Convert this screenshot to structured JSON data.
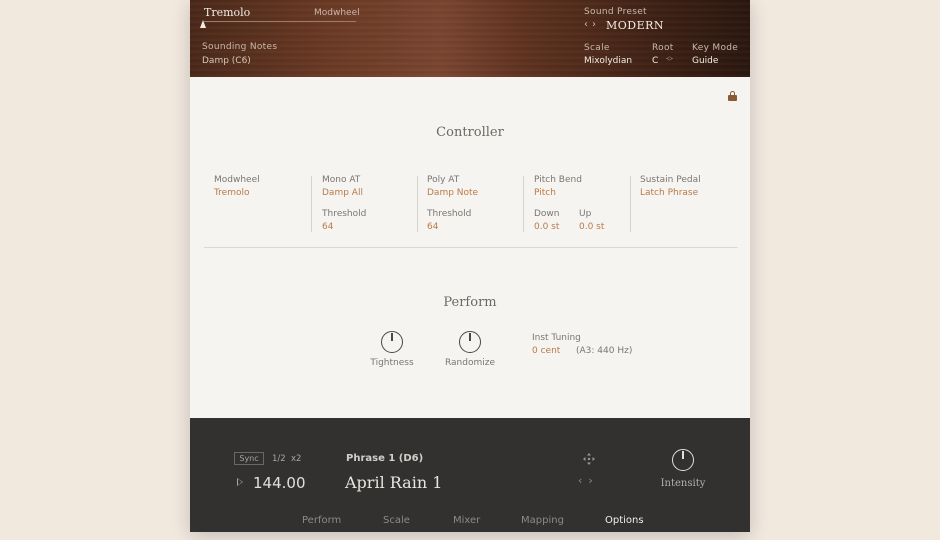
{
  "header": {
    "modwheel_target": "Tremolo",
    "modwheel_label": "Modwheel",
    "sounding_notes_label": "Sounding Notes",
    "sounding_notes_value": "Damp (C6)",
    "sound_preset_label": "Sound Preset",
    "preset_prev": "‹",
    "preset_next": "›",
    "sound_preset_value": "MODERN",
    "scale_label": "Scale",
    "scale_value": "Mixolydian",
    "root_label": "Root",
    "root_value": "C",
    "key_mode_label": "Key Mode",
    "key_mode_value": "Guide",
    "lock_icon": "lock-icon"
  },
  "controller": {
    "title": "Controller",
    "columns": [
      {
        "label": "Modwheel",
        "value": "Tremolo"
      },
      {
        "label": "Mono AT",
        "value": "Damp All",
        "sub_label": "Threshold",
        "sub_value": "64"
      },
      {
        "label": "Poly AT",
        "value": "Damp Note",
        "sub_label": "Threshold",
        "sub_value": "64"
      },
      {
        "label": "Pitch Bend",
        "value": "Pitch",
        "down_label": "Down",
        "down_value": "0.0 st",
        "up_label": "Up",
        "up_value": "0.0 st"
      },
      {
        "label": "Sustain Pedal",
        "value": "Latch Phrase"
      }
    ]
  },
  "perform": {
    "title": "Perform",
    "tightness_label": "Tightness",
    "randomize_label": "Randomize",
    "inst_tuning_label": "Inst Tuning",
    "inst_tuning_value": "0 cent",
    "inst_tuning_ref": "(A3: 440 Hz)"
  },
  "footer": {
    "sync_label": "Sync",
    "half_label": "1/2",
    "double_label": "x2",
    "tempo": "144.00",
    "phrase_label": "Phrase 1 (D6)",
    "phrase_name": "April Rain  1",
    "phrase_prev": "‹",
    "phrase_next": "›",
    "intensity_label": "Intensity",
    "tabs": [
      "Perform",
      "Scale",
      "Mixer",
      "Mapping",
      "Options"
    ],
    "active_tab": "Options"
  },
  "colors": {
    "accent": "#b87a4a",
    "footer_bg": "#323130",
    "panel_bg": "#f6f4f0",
    "page_bg": "#f1e8de"
  }
}
